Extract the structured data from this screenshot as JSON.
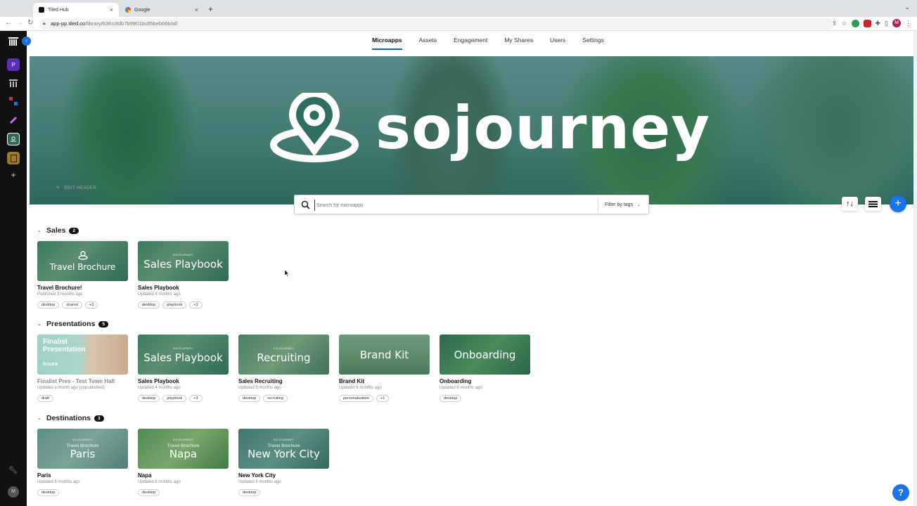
{
  "browser": {
    "tabs": [
      {
        "title": "Tiled Hub",
        "active": true
      },
      {
        "title": "Google",
        "active": false
      }
    ],
    "url_main": "app-pp.tiled.co",
    "url_path": "/library/63fcc8db7b9901bc85beb66b/all",
    "profile_initial": "M"
  },
  "rail": {
    "items": [
      {
        "name": "tiled-logo-icon"
      },
      {
        "label": "P",
        "color": "#5b2fb5"
      },
      {
        "name": "grid-icon"
      },
      {
        "name": "app-icon-red"
      },
      {
        "name": "app-icon-purple"
      },
      {
        "name": "app-icon-active"
      },
      {
        "name": "app-icon-book"
      },
      {
        "name": "add-workspace-icon"
      }
    ],
    "user_initial": "M"
  },
  "nav": {
    "items": [
      "Microapps",
      "Assets",
      "Engagement",
      "My Shares",
      "Users",
      "Settings"
    ],
    "active": "Microapps"
  },
  "hero": {
    "brand": "sojourney",
    "edit_label": "EDIT HEADER"
  },
  "search": {
    "placeholder": "Search for microapps",
    "filter_label": "Filter by tags"
  },
  "sections": [
    {
      "name": "Sales",
      "count": "2",
      "cards": [
        {
          "thumb_text": "Travel Brochure",
          "title": "Travel Brochure!",
          "sub": "Published 3 months ago",
          "tags": [
            "desktop",
            "shared",
            "+3"
          ]
        },
        {
          "thumb_text": "Sales Playbook",
          "title": "Sales Playbook",
          "sub": "Updated 4 months ago",
          "tags": [
            "desktop",
            "playbook",
            "+3"
          ]
        }
      ]
    },
    {
      "name": "Presentations",
      "count": "5",
      "cards": [
        {
          "thumb_text": "Finalist Presentation",
          "thumb_brand": "Insura",
          "title": "Finalist Pres - Test Town Hall",
          "sub": "Updated a month ago (unpublished)",
          "tags": [
            "draft"
          ]
        },
        {
          "thumb_text": "Sales Playbook",
          "title": "Sales Playbook",
          "sub": "Updated 4 months ago",
          "tags": [
            "desktop",
            "playbook",
            "+3"
          ]
        },
        {
          "thumb_text": "Recruiting",
          "title": "Sales Recruiting",
          "sub": "Updated 5 months ago",
          "tags": [
            "desktop",
            "recruiting"
          ]
        },
        {
          "thumb_text": "Brand Kit",
          "title": "Brand Kit",
          "sub": "Updated 6 months ago",
          "tags": [
            "personalization",
            "+1"
          ]
        },
        {
          "thumb_text": "Onboarding",
          "title": "Onboarding",
          "sub": "Updated 6 months ago",
          "tags": [
            "desktop"
          ]
        }
      ]
    },
    {
      "name": "Destinations",
      "count": "3",
      "cards": [
        {
          "thumb_small": "Travel Brochure",
          "thumb_text": "Paris",
          "title": "Paris",
          "sub": "Updated 6 months ago",
          "tags": [
            "desktop"
          ]
        },
        {
          "thumb_small": "Travel Brochure",
          "thumb_text": "Napa",
          "title": "Napa",
          "sub": "Updated 6 months ago",
          "tags": [
            "desktop"
          ]
        },
        {
          "thumb_small": "Travel Brochure",
          "thumb_text": "New York City",
          "title": "New York City",
          "sub": "Updated 6 months ago",
          "tags": [
            "desktop"
          ]
        }
      ]
    }
  ],
  "thumb_mini_label": "SOJOURNEY",
  "help_label": "?",
  "accent": "#1a73e8"
}
